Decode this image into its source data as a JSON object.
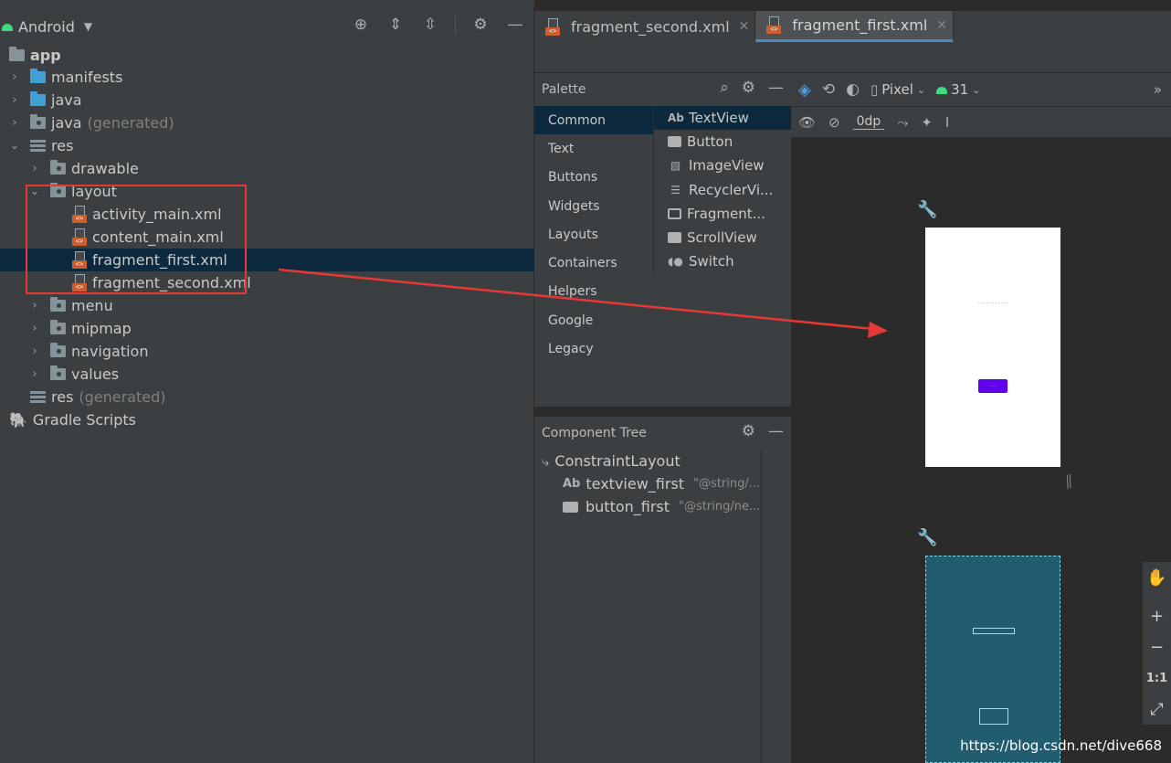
{
  "project": {
    "view_label": "Android",
    "tree": [
      {
        "label": "app",
        "bold": true
      },
      {
        "label": "manifests"
      },
      {
        "label": "java"
      },
      {
        "label": "java",
        "suffix": "(generated)"
      },
      {
        "label": "res"
      },
      {
        "label": "drawable"
      },
      {
        "label": "layout"
      },
      {
        "label": "activity_main.xml"
      },
      {
        "label": "content_main.xml"
      },
      {
        "label": "fragment_first.xml",
        "selected": true
      },
      {
        "label": "fragment_second.xml"
      },
      {
        "label": "menu"
      },
      {
        "label": "mipmap"
      },
      {
        "label": "navigation"
      },
      {
        "label": "values"
      },
      {
        "label": "res",
        "suffix": "(generated)"
      },
      {
        "label": "Gradle Scripts"
      }
    ]
  },
  "tabs": [
    {
      "label": "fragment_second.xml",
      "active": false
    },
    {
      "label": "fragment_first.xml",
      "active": true
    }
  ],
  "palette": {
    "title": "Palette",
    "categories": [
      "Common",
      "Text",
      "Buttons",
      "Widgets",
      "Layouts",
      "Containers",
      "Helpers",
      "Google",
      "Legacy"
    ],
    "selected_category": "Common",
    "items": [
      {
        "icon": "Ab",
        "label": "TextView"
      },
      {
        "icon": "button-icon",
        "label": "Button"
      },
      {
        "icon": "image-icon",
        "label": "ImageView"
      },
      {
        "icon": "list-icon",
        "label": "RecyclerVi..."
      },
      {
        "icon": "fragment-icon",
        "label": "Fragment..."
      },
      {
        "icon": "scroll-icon",
        "label": "ScrollView"
      },
      {
        "icon": "switch-icon",
        "label": "Switch"
      }
    ]
  },
  "component_tree": {
    "title": "Component Tree",
    "root": "ConstraintLayout",
    "children": [
      {
        "icon": "Ab",
        "label": "textview_first",
        "attr": "\"@string/..."
      },
      {
        "icon": "button-icon",
        "label": "button_first",
        "attr": "\"@string/ne..."
      }
    ]
  },
  "design_toolbar": {
    "device": "Pixel",
    "api": "31",
    "margin": "0dp"
  },
  "zoom_controls": {
    "ratio_label": "1:1"
  },
  "watermark": "https://blog.csdn.net/dive668",
  "colors": {
    "selection": "#0d293e",
    "annotation": "#e53935",
    "button_preview": "#6200ee",
    "blueprint": "#225c6f"
  }
}
